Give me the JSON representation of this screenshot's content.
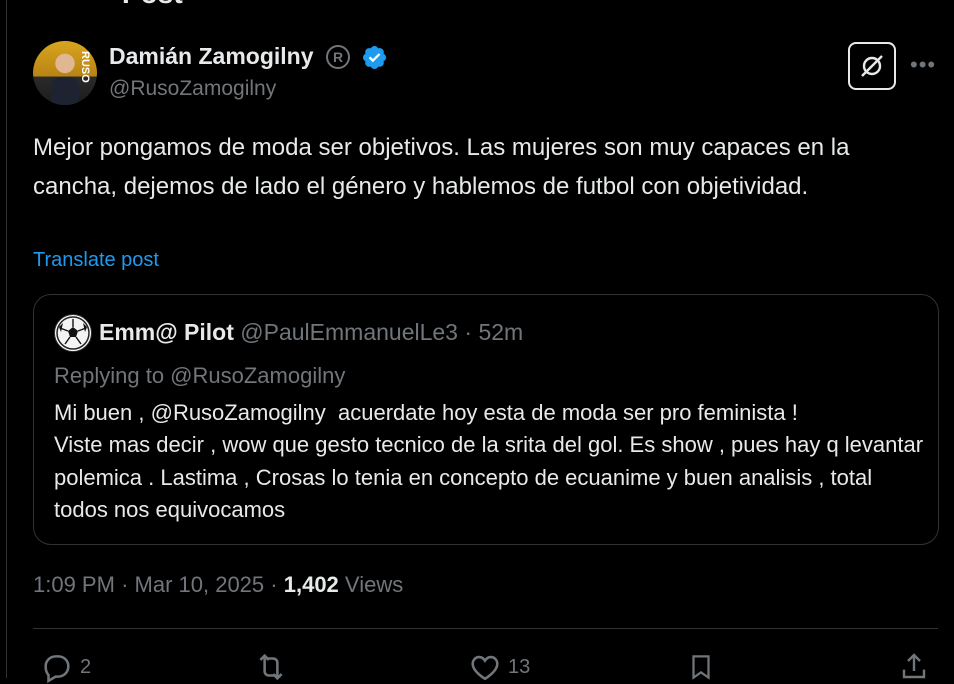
{
  "header": {
    "title_fragment": "Post"
  },
  "author": {
    "name": "Damián Zamogilny",
    "reg_symbol": "R",
    "handle": "@RusoZamogilny",
    "avatar_brand": "RUSO"
  },
  "tweet": {
    "text": "Mejor pongamos de moda ser objetivos. Las mujeres son muy capaces en la cancha, dejemos de lado el género y hablemos de futbol con objetividad.",
    "translate_label": "Translate post"
  },
  "quote": {
    "name": "Emm@ Pilot",
    "handle": "@PaulEmmanuelLe3",
    "separator": "·",
    "time": "52m",
    "replying_to": "Replying to @RusoZamogilny",
    "text": "Mi buen , @RusoZamogilny  acuerdate hoy esta de moda ser pro feminista !\nViste mas decir , wow que gesto tecnico de la srita del gol. Es show , pues hay q levantar polemica . Lastima , Crosas lo tenia en concepto de ecuanime y buen analisis , total todos nos equivocamos"
  },
  "meta": {
    "time": "1:09 PM",
    "sep1": "·",
    "date": "Mar 10, 2025",
    "sep2": "·",
    "views_count": "1,402",
    "views_label": "Views"
  },
  "actions": {
    "replies": "2",
    "reposts": "",
    "likes": "13"
  },
  "colors": {
    "background": "#000000",
    "text": "#e7e9ea",
    "muted": "#71767b",
    "accent": "#1d9bf0",
    "border": "#2f3336"
  },
  "icons": [
    "back-arrow-icon",
    "registered-icon",
    "verified-badge-icon",
    "grok-icon",
    "more-icon",
    "soccer-ball-icon",
    "reply-icon",
    "repost-icon",
    "like-icon",
    "bookmark-icon",
    "share-icon"
  ]
}
